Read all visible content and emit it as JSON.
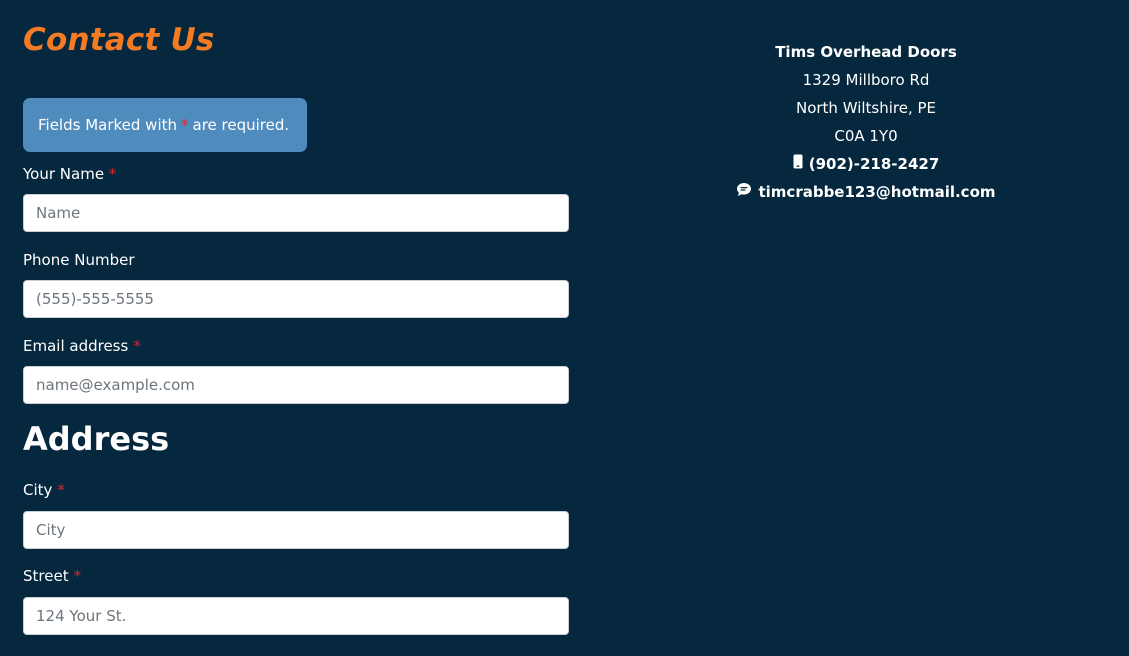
{
  "page": {
    "title": "Contact Us",
    "required_notice": {
      "before": "Fields Marked with",
      "star": "*",
      "after": "are required."
    }
  },
  "form": {
    "name": {
      "label": "Your Name",
      "required_marker": "*",
      "placeholder": "Name"
    },
    "phone": {
      "label": "Phone Number",
      "placeholder": "(555)-555-5555"
    },
    "email": {
      "label": "Email address",
      "required_marker": "*",
      "placeholder": "name@example.com"
    },
    "address_heading": "Address",
    "city": {
      "label": "City",
      "required_marker": "*",
      "placeholder": "City"
    },
    "street": {
      "label": "Street",
      "required_marker": "*",
      "placeholder": "124 Your St."
    }
  },
  "contact": {
    "business_name": "Tims Overhead Doors",
    "address_line1": "1329 Millboro Rd",
    "address_line2": "North Wiltshire, PE",
    "postal_code": "C0A 1Y0",
    "phone": "(902)-218-2427",
    "email": "timcrabbe123@hotmail.com",
    "icons": {
      "phone": "mobile-phone-icon",
      "email": "chat-bubble-icon"
    }
  },
  "colors": {
    "background": "#05283e",
    "accent": "#f47a24",
    "notice_bg": "#4f8bbd",
    "required": "#e8202a"
  }
}
